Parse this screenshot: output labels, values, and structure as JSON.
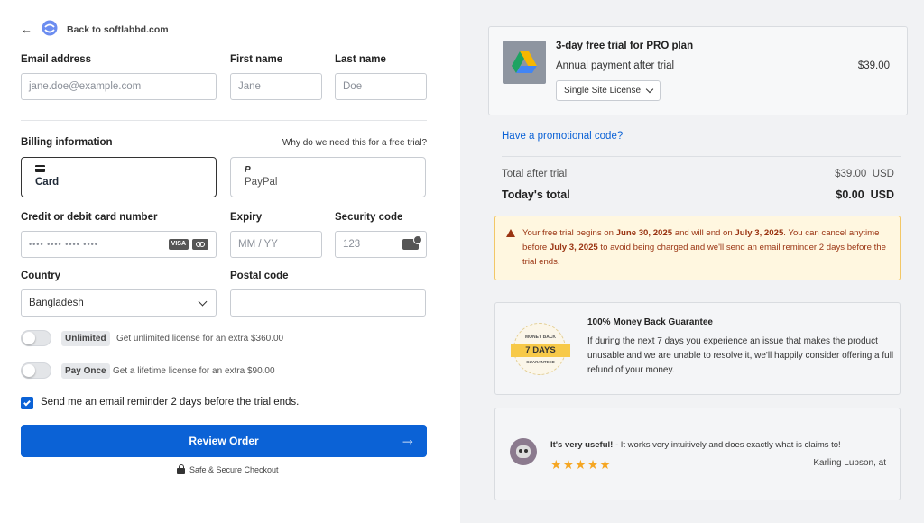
{
  "back_link": {
    "label": "Back to softlabbd.com"
  },
  "form": {
    "email_label": "Email address",
    "email_placeholder": "jane.doe@example.com",
    "first_name_label": "First name",
    "first_name_placeholder": "Jane",
    "last_name_label": "Last name",
    "last_name_placeholder": "Doe",
    "billing_label": "Billing information",
    "why_link": "Why do we need this for a free trial?",
    "methods": [
      {
        "label": "Card",
        "icon": "card-icon"
      },
      {
        "label": "PayPal",
        "icon": "paypal-icon"
      }
    ],
    "card_number_label": "Credit or debit card number",
    "card_number_placeholder": "•••• •••• •••• ••••",
    "expiry_label": "Expiry",
    "expiry_placeholder": "MM / YY",
    "security_label": "Security code",
    "security_placeholder": "123",
    "country_label": "Country",
    "country_value": "Bangladesh",
    "postal_label": "Postal code",
    "addons": [
      {
        "chip": "Unlimited",
        "text": "Get unlimited license for an extra $360.00",
        "on": false
      },
      {
        "chip": "Pay Once",
        "text": "Get a lifetime license for an extra $90.00",
        "on": false
      }
    ],
    "reminder_label": "Send me an email reminder 2 days before the trial ends.",
    "review_button": "Review Order",
    "secure_text": "Safe & Secure Checkout"
  },
  "summary": {
    "product_title": "3-day free trial for PRO plan",
    "product_subtitle": "Annual payment after trial",
    "product_price": "$39.00",
    "license_select": "Single Site License",
    "promo_link": "Have a promotional code?",
    "total_after_label": "Total after trial",
    "total_after_value": "$39.00  USD",
    "today_label": "Today's total",
    "today_value": "$0.00  USD"
  },
  "notice": {
    "p1": "Your free trial begins on ",
    "d1": "June 30, 2025",
    "p2": " and will end on ",
    "d2": "July 3, 2025",
    "p3": ". You can cancel anytime before ",
    "d3": "July 3, 2025",
    "p4": " to avoid being charged and we'll send an email reminder 2 days before the trial ends."
  },
  "guarantee": {
    "badge_top": "MONEY BACK",
    "badge_main": "7 DAYS",
    "badge_bottom": "GUARANTEED",
    "title": "100% Money Back Guarantee",
    "text": "If during the next 7 days you experience an issue that makes the product unusable and we are unable to resolve it, we'll happily consider offering a full refund of your money."
  },
  "review": {
    "bold": "It's very useful!",
    "text": " - It works very intuitively and does exactly what is claims to!",
    "stars": 5,
    "author": "Karling Lupson, at"
  },
  "colors": {
    "accent": "#0b62d6",
    "notice_bg": "#fff7e0",
    "notice_text": "#9a3412",
    "star": "#f5a623"
  }
}
